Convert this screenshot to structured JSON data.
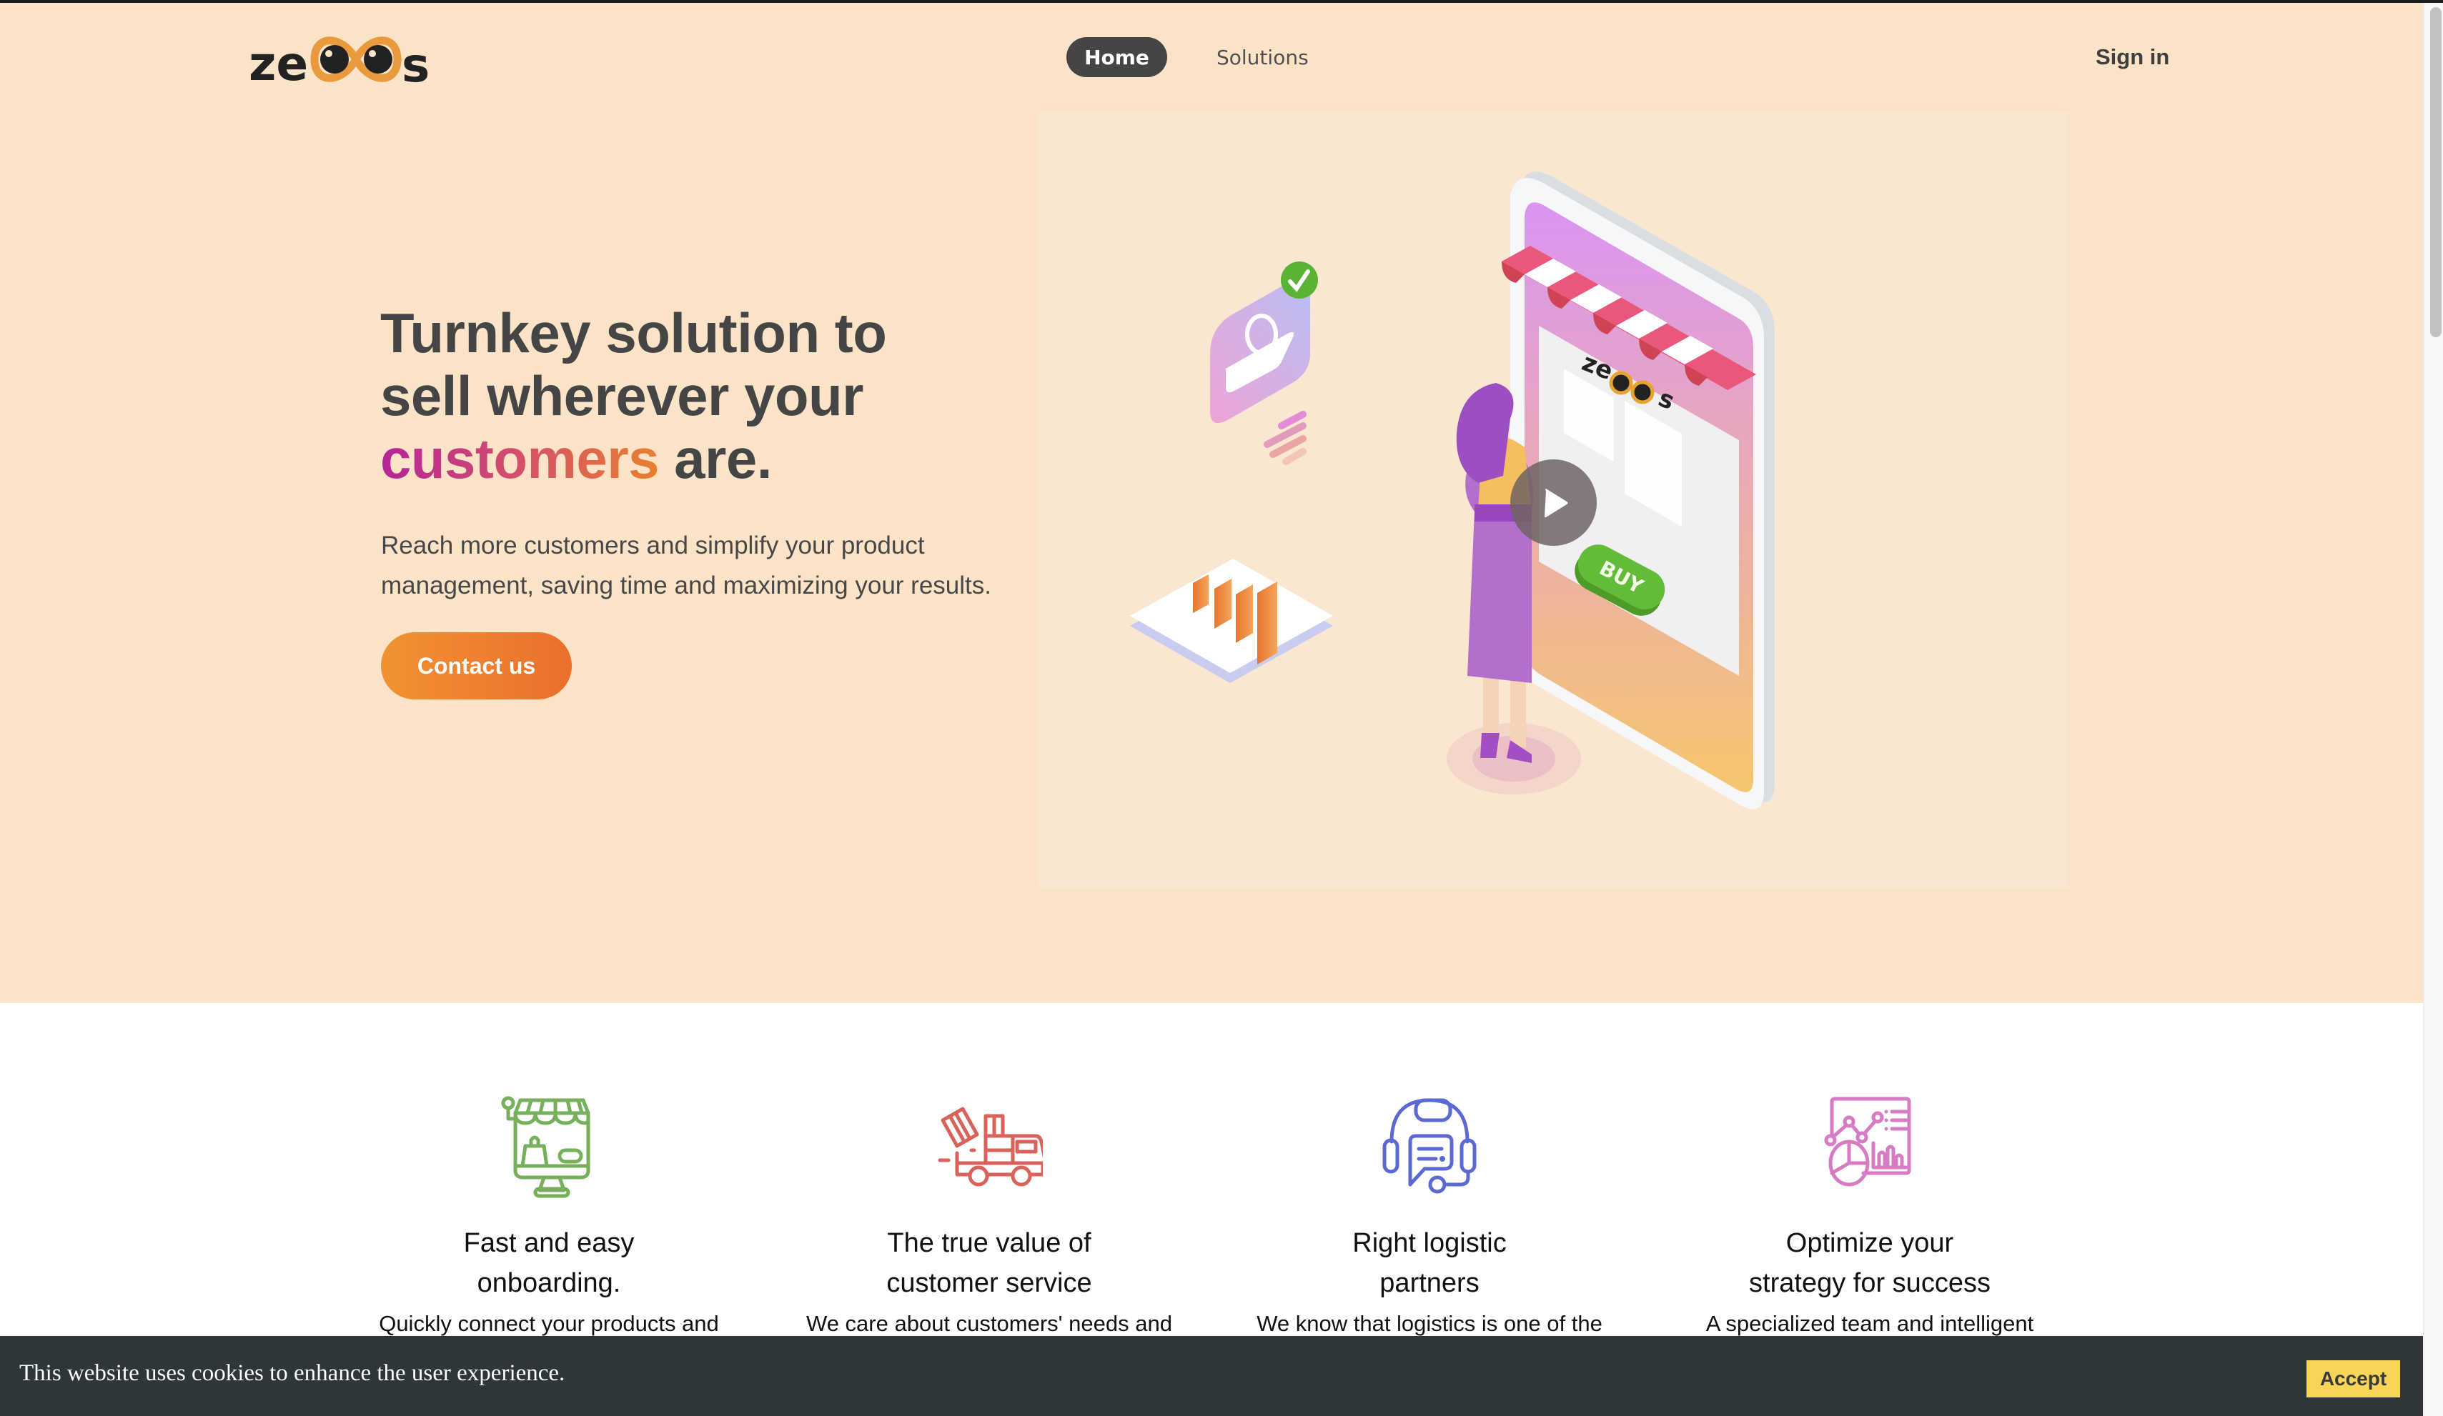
{
  "header": {
    "logo_text": "zeoos",
    "nav": [
      {
        "label": "Home",
        "active": true
      },
      {
        "label": "Solutions",
        "active": false
      }
    ],
    "sign_in_label": "Sign in"
  },
  "hero": {
    "headline_line1": "Turnkey solution to",
    "headline_line2": "sell wherever your",
    "headline_highlight": "customers",
    "headline_end": " are.",
    "subtext": "Reach more customers and simplify your product management, saving time and maximizing your results.",
    "cta_label": "Contact us",
    "video": {
      "play_icon": "play-icon",
      "illustration_buy_label": "BUY",
      "illustration_logo_text": "zeoos"
    }
  },
  "features": [
    {
      "icon": "online-store-icon",
      "color": "#76B05A",
      "title": "Fast and easy onboarding.",
      "desc": "Quickly connect your products and"
    },
    {
      "icon": "delivery-truck-icon",
      "color": "#D9635A",
      "title": "The true value of customer service",
      "desc": "We care about customers' needs and"
    },
    {
      "icon": "support-headset-icon",
      "color": "#5B6AD3",
      "title": "Right logistic partners",
      "desc": "We know that logistics is one of the"
    },
    {
      "icon": "analytics-dashboard-icon",
      "color": "#D87BC5",
      "title": "Optimize your strategy for success",
      "desc": "A specialized team and intelligent"
    }
  ],
  "cookie_banner": {
    "text": "This website uses cookies to enhance the user experience.",
    "accept_label": "Accept"
  },
  "colors": {
    "hero_bg": "#FBE3C8",
    "accent_orange": "#EE7E2E",
    "nav_active_bg": "#454545",
    "cookie_bg": "#2F3639",
    "accept_bg": "#F7D557"
  }
}
